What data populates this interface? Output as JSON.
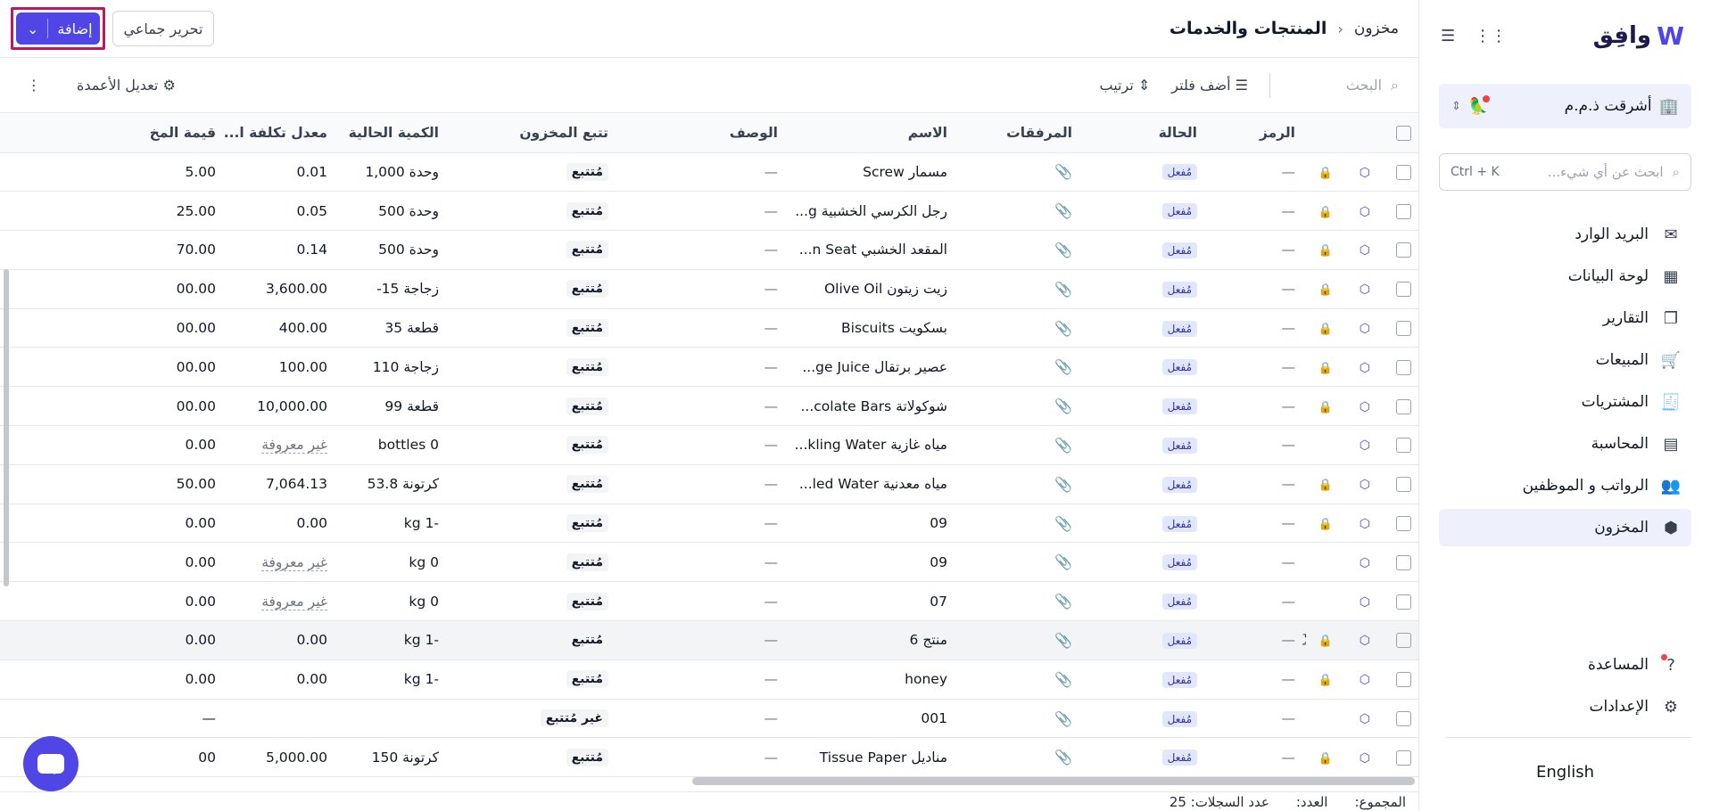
{
  "sidebar": {
    "logo_text": "وافِق",
    "company": {
      "name": "أشرقت ذ.م.م",
      "emoji": "🦜"
    },
    "search": {
      "placeholder": "ابحث عن أي شيء...",
      "shortcut": "Ctrl + K"
    },
    "items": [
      {
        "label": "البريد الوارد",
        "icon": "inbox-icon",
        "glyph": "✉"
      },
      {
        "label": "لوحة البيانات",
        "icon": "dashboard-icon",
        "glyph": "▦"
      },
      {
        "label": "التقارير",
        "icon": "reports-icon",
        "glyph": "❐"
      },
      {
        "label": "المبيعات",
        "icon": "cart-icon",
        "glyph": "🛒"
      },
      {
        "label": "المشتريات",
        "icon": "receipt-icon",
        "glyph": "🧾"
      },
      {
        "label": "المحاسبة",
        "icon": "ledger-icon",
        "glyph": "▤"
      },
      {
        "label": "الرواتب و الموظفين",
        "icon": "users-icon",
        "glyph": "👥"
      },
      {
        "label": "المخزون",
        "icon": "box-icon",
        "glyph": "⬢"
      }
    ],
    "help": "المساعدة",
    "settings": "الإعدادات",
    "language": "English"
  },
  "header": {
    "breadcrumb_parent": "مخزون",
    "title": "المنتجات والخدمات",
    "bulk_edit": "تحرير جماعي",
    "add": "إضافة"
  },
  "toolbar": {
    "search_placeholder": "البحث",
    "add_filter": "أضف فلتر",
    "sort": "ترتيب",
    "edit_columns": "تعديل الأعمدة"
  },
  "table": {
    "headers": [
      "",
      "",
      "",
      "الرمز",
      "الحالة",
      "المرفقات",
      "الاسم",
      "الوصف",
      "تتبع المخزون",
      "الكمية الحالية",
      "معدل تكلفة ا...",
      "قيمة المخ"
    ],
    "rows": [
      {
        "lock": true,
        "code": "—",
        "status": "مُفعل",
        "name": "مسمار Screw",
        "desc": "—",
        "track": "مُتتبع",
        "qty": "وحدة 1,000",
        "cost": "0.01",
        "value": "5.00"
      },
      {
        "lock": true,
        "code": "—",
        "status": "مُفعل",
        "name": "رجل الكرسي الخشبية g...",
        "desc": "—",
        "track": "مُتتبع",
        "qty": "وحدة 500",
        "cost": "0.05",
        "value": "25.00"
      },
      {
        "lock": true,
        "code": "—",
        "status": "مُفعل",
        "name": "المقعد الخشبي n Seat...",
        "desc": "—",
        "track": "مُتتبع",
        "qty": "وحدة 500",
        "cost": "0.14",
        "value": "70.00"
      },
      {
        "lock": true,
        "code": "—",
        "status": "مُفعل",
        "name": "زيت زيتون Olive Oil",
        "desc": "—",
        "track": "مُتتبع",
        "qty": "زجاجة 15-",
        "cost": "3,600.00",
        "value": "00.00"
      },
      {
        "lock": true,
        "code": "—",
        "status": "مُفعل",
        "name": "بسكويت Biscuits",
        "desc": "—",
        "track": "مُتتبع",
        "qty": "قطعة 35",
        "cost": "400.00",
        "value": "00.00"
      },
      {
        "lock": true,
        "code": "—",
        "status": "مُفعل",
        "name": "عصير برتقال ge Juice...",
        "desc": "—",
        "track": "مُتتبع",
        "qty": "زجاجة 110",
        "cost": "100.00",
        "value": "00.00"
      },
      {
        "lock": true,
        "code": "—",
        "status": "مُفعل",
        "name": "شوكولاتة colate Bars...",
        "desc": "—",
        "track": "مُتتبع",
        "qty": "قطعة 99",
        "cost": "10,000.00",
        "value": "00.00"
      },
      {
        "lock": false,
        "code": "—",
        "status": "مُفعل",
        "name": "مياه غازية kling Water...",
        "desc": "—",
        "track": "مُتتبع",
        "qty": "0 bottles",
        "cost": "غير معروفة",
        "cost_unknown": true,
        "value": "0.00"
      },
      {
        "lock": true,
        "code": "—",
        "status": "مُفعل",
        "name": "مياه معدنية led Water...",
        "desc": "—",
        "track": "مُتتبع",
        "qty": "كرتونة 53.8",
        "cost": "7,064.13",
        "value": "50.00"
      },
      {
        "lock": true,
        "code": "—",
        "status": "مُفعل",
        "name": "09",
        "desc": "—",
        "track": "مُتتبع",
        "qty": "-1 kg",
        "cost": "0.00",
        "value": "0.00"
      },
      {
        "lock": false,
        "code": "—",
        "status": "مُفعل",
        "name": "09",
        "desc": "—",
        "track": "مُتتبع",
        "qty": "0 kg",
        "cost": "غير معروفة",
        "cost_unknown": true,
        "value": "0.00"
      },
      {
        "lock": false,
        "code": "—",
        "status": "مُفعل",
        "name": "07",
        "desc": "—",
        "track": "مُتتبع",
        "qty": "0 kg",
        "cost": "غير معروفة",
        "cost_unknown": true,
        "value": "0.00"
      },
      {
        "lock": true,
        "expand": true,
        "code": "—",
        "status": "مُفعل",
        "name": "منتج 6",
        "desc": "—",
        "track": "مُتتبع",
        "qty": "-1 kg",
        "cost": "0.00",
        "value": "0.00"
      },
      {
        "lock": true,
        "code": "—",
        "status": "مُفعل",
        "name": "honey",
        "desc": "—",
        "track": "مُتتبع",
        "qty": "-1 kg",
        "cost": "0.00",
        "value": "0.00"
      },
      {
        "lock": false,
        "code": "—",
        "status": "مُفعل",
        "name": "001",
        "desc": "—",
        "track": "غير مُتتبع",
        "qty": "",
        "cost": "",
        "value": "—"
      },
      {
        "lock": true,
        "code": "—",
        "status": "مُفعل",
        "name": "مناديل Tissue Paper",
        "desc": "—",
        "track": "مُتتبع",
        "qty": "كرتونة 150",
        "cost": "5,000.00",
        "value": "00"
      }
    ]
  },
  "footer": {
    "total": "المجموع:",
    "count": "العدد:",
    "records": "عدد السجلات: 25"
  },
  "colors": {
    "accent": "#4f46e5",
    "highlight_border": "#c0185a"
  }
}
